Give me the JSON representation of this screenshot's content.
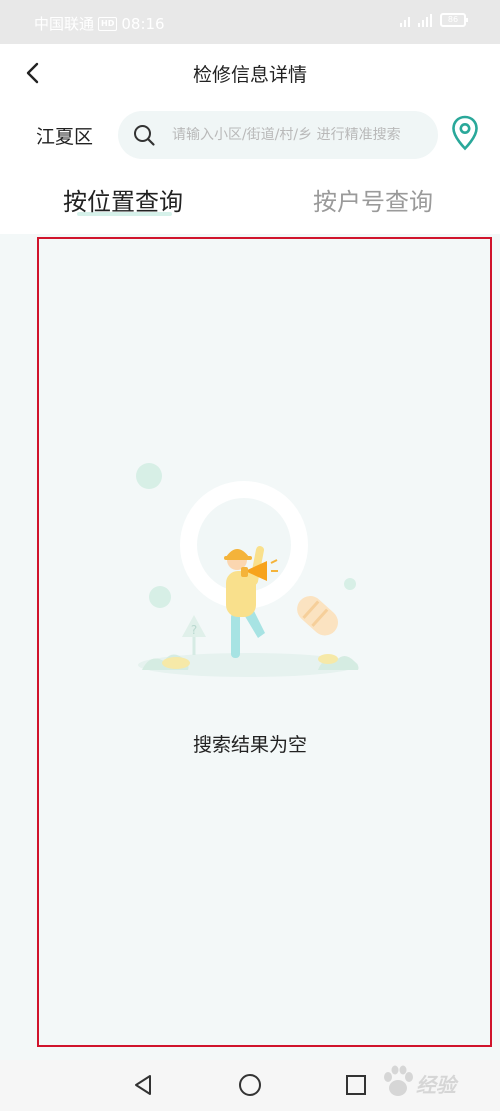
{
  "status_bar": {
    "carrier": "中国联通",
    "network_badge": "HD",
    "time": "08:16",
    "battery": "86"
  },
  "header": {
    "title": "检修信息详情",
    "back_icon": "chevron-left-icon"
  },
  "search": {
    "district": "江夏区",
    "placeholder": "请输入小区/街道/村/乡 进行精准搜索",
    "value": "",
    "search_icon": "search-icon",
    "location_icon": "location-pin-icon"
  },
  "tabs": [
    {
      "label": "按位置查询",
      "active": true
    },
    {
      "label": "按户号查询",
      "active": false
    }
  ],
  "empty_state": {
    "message": "搜索结果为空",
    "illustration": "magnifier-person-megaphone-illustration"
  },
  "nav": {
    "back_icon": "triangle-back-icon",
    "home_icon": "circle-home-icon",
    "recent_icon": "square-recent-icon"
  },
  "watermark": {
    "text": "经验",
    "logo": "baidu-paw-logo"
  },
  "colors": {
    "accent": "#2aa89a",
    "tab_underline": "#d6f1ea",
    "content_bg": "#f3f8f8",
    "highlight_border": "#d0142c"
  }
}
